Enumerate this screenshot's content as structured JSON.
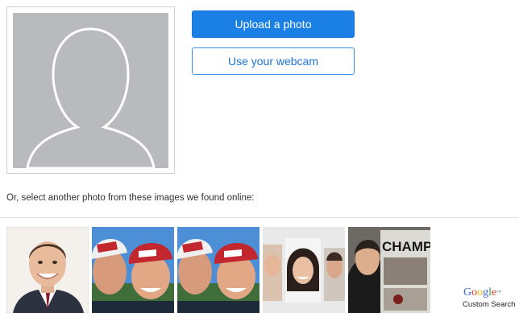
{
  "actions": {
    "upload_label": "Upload a photo",
    "webcam_label": "Use your webcam"
  },
  "found": {
    "text": "Or, select another photo from these images we found online:",
    "images": [
      {
        "icon": "portrait-photo-man-suit"
      },
      {
        "icon": "photo-two-men-caps"
      },
      {
        "icon": "photo-two-men-caps"
      },
      {
        "icon": "photo-collage-faces"
      },
      {
        "icon": "photo-man-newspaper-champs"
      }
    ],
    "thumbnail_text": "CHAMPS"
  },
  "branding": {
    "google_letters": [
      "G",
      "o",
      "o",
      "g",
      "l",
      "e"
    ],
    "google_tm": "™",
    "google_sub": "Custom Search"
  },
  "colors": {
    "primary": "#1a80e6",
    "avatar_bg": "#b8babd"
  }
}
